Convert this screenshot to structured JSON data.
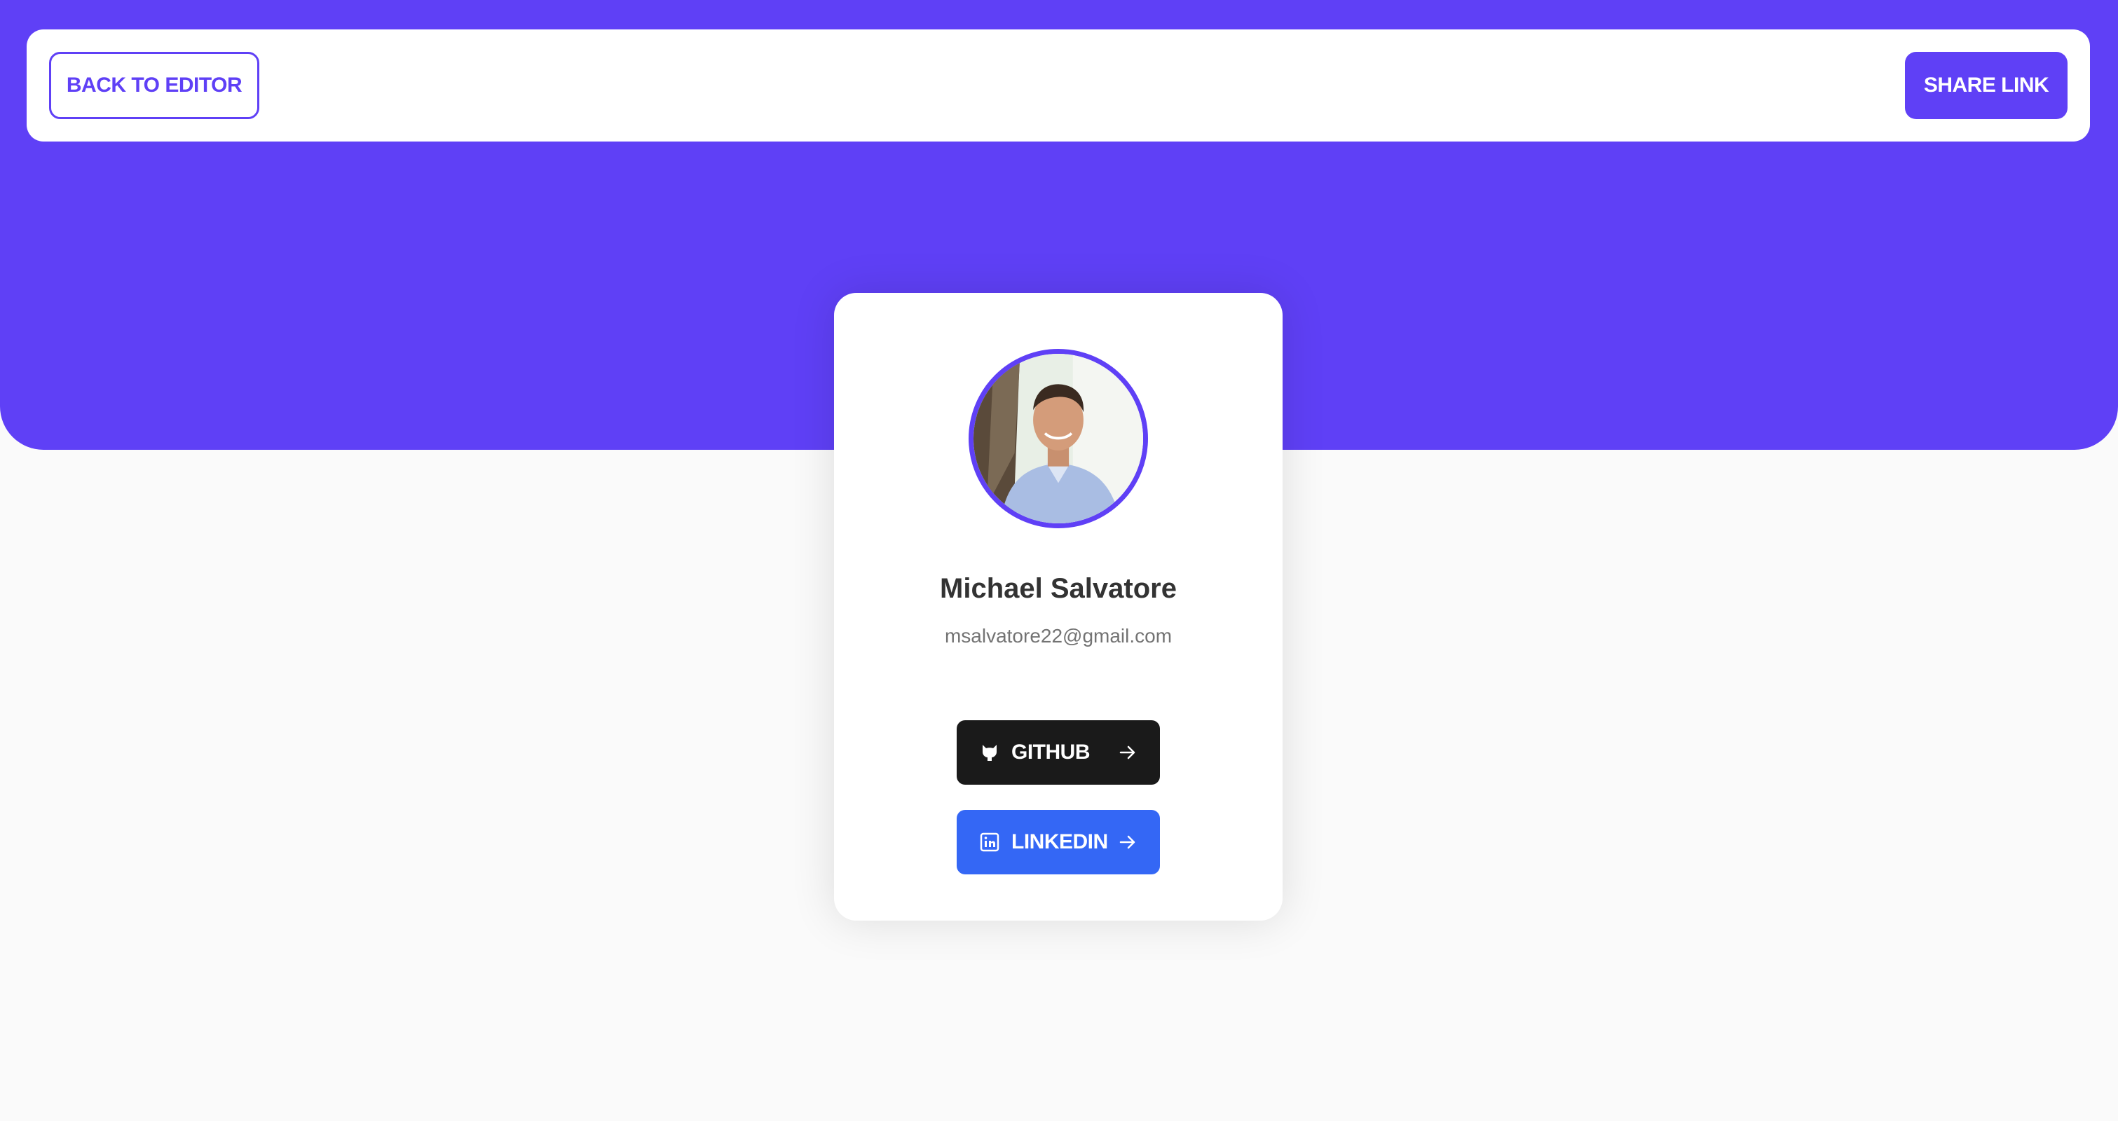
{
  "header": {
    "back_label": "BACK TO EDITOR",
    "share_label": "SHARE LINK"
  },
  "profile": {
    "name": "Michael Salvatore",
    "email": "msalvatore22@gmail.com",
    "avatar_icon": "profile-photo"
  },
  "links": [
    {
      "label": "GITHUB",
      "icon": "github-icon",
      "color": "#1a1a1a"
    },
    {
      "label": "LINKEDIN",
      "icon": "linkedin-icon",
      "color": "#3467f5"
    }
  ],
  "colors": {
    "accent": "#5f40f6",
    "background": "#fafafa",
    "card": "#ffffff"
  }
}
